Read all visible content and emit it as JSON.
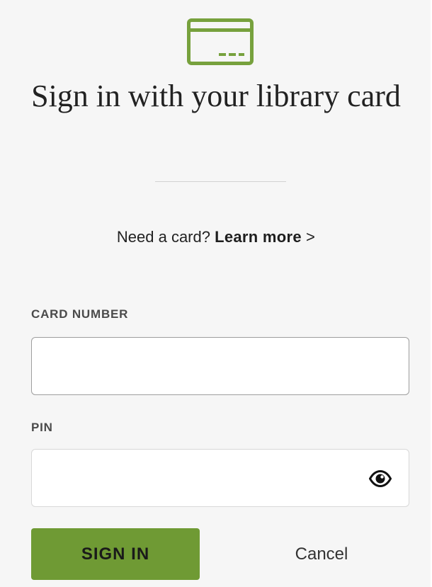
{
  "header": {
    "icon": "library-card-icon",
    "title": "Sign in with your library card"
  },
  "need_card": {
    "prompt": "Need a card?",
    "link_label": "Learn more",
    "link_chevron": ">"
  },
  "form": {
    "card_number": {
      "label": "CARD NUMBER",
      "value": "",
      "placeholder": ""
    },
    "pin": {
      "label": "PIN",
      "value": "",
      "placeholder": "",
      "visibility_icon": "eye-icon"
    }
  },
  "actions": {
    "sign_in_label": "SIGN IN",
    "cancel_label": "Cancel"
  },
  "colors": {
    "accent": "#6f9a34",
    "icon": "#77a13d",
    "background": "#f6f6f6"
  }
}
